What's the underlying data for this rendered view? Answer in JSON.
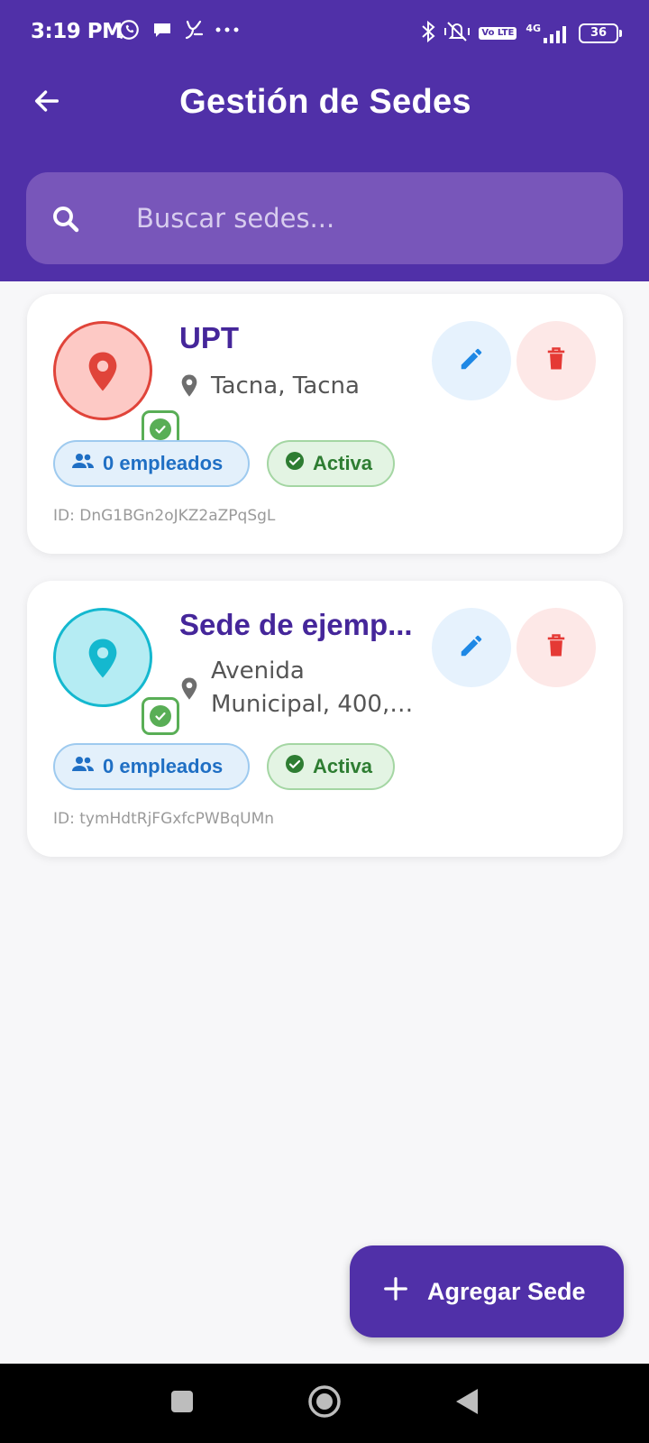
{
  "status_bar": {
    "time": "3:19 PM",
    "left_icons": [
      "whatsapp-icon",
      "chat-bubble-icon",
      "yape-icon",
      "more-dots-icon"
    ],
    "right_icons": [
      "bluetooth-icon",
      "vibrate-mute-icon",
      "volte-icon",
      "signal-icon",
      "battery-icon"
    ],
    "volte_label": "Vo LTE",
    "network": "4G",
    "battery": "36"
  },
  "app_bar": {
    "title": "Gestión de Sedes",
    "back_icon": "arrow-left-icon"
  },
  "search": {
    "placeholder": "Buscar sedes...",
    "icon": "search-icon"
  },
  "sites": [
    {
      "name": "UPT",
      "location": "Tacna, Tacna",
      "employees_label": "0 empleados",
      "status_label": "Activa",
      "id_label": "ID: DnG1BGn2oJKZ2aZPqSgL",
      "avatar_color": "#e0443a"
    },
    {
      "name": "Sede de ejemp...",
      "location": "Avenida Municipal, 400, T...",
      "employees_label": "0 empleados",
      "status_label": "Activa",
      "id_label": "ID: tymHdtRjFGxfcPWBqUMn",
      "avatar_color": "#14b8cf"
    }
  ],
  "fab": {
    "label": "Agregar Sede",
    "icon": "plus-icon"
  },
  "nav_bar": {
    "buttons": [
      "recent-apps-icon",
      "home-icon",
      "back-triangle-icon"
    ]
  },
  "colors": {
    "primary": "#5030a8",
    "search_bg": "#7856ba",
    "edit": "#1e88e5",
    "delete": "#e53935",
    "success": "#59ae56"
  }
}
